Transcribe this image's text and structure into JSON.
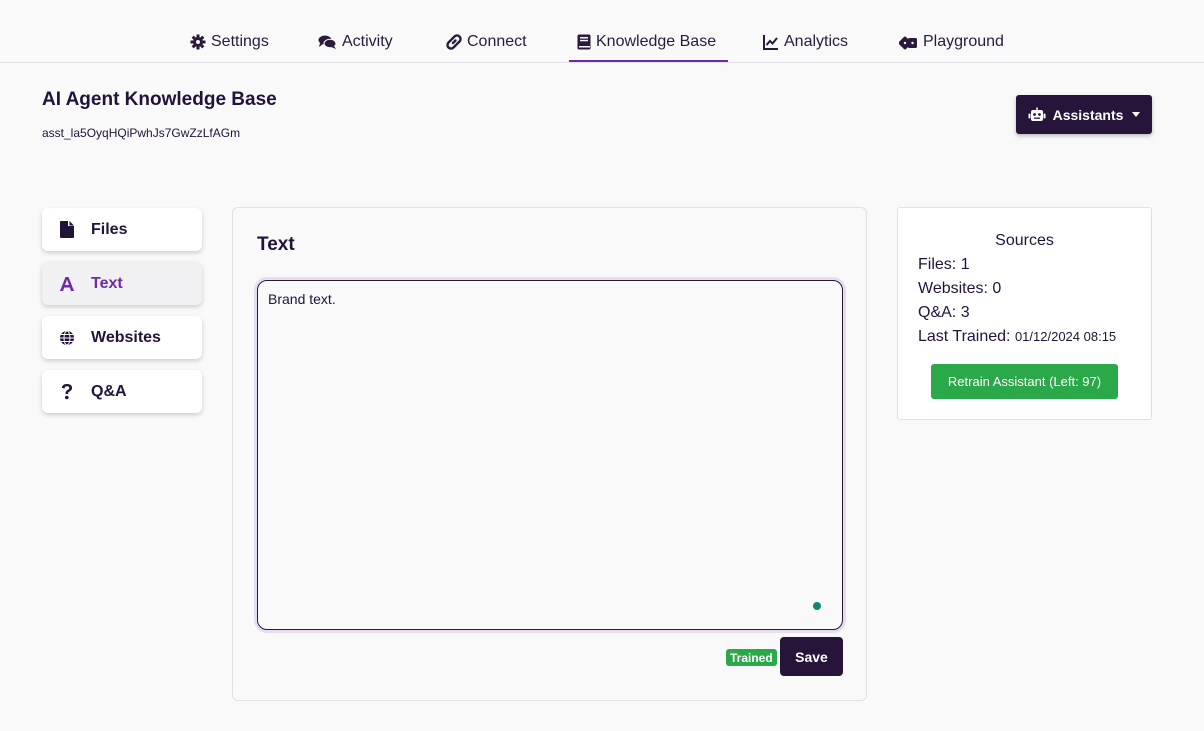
{
  "nav": {
    "tabs": [
      {
        "label": "Settings",
        "icon": "gear-icon"
      },
      {
        "label": "Activity",
        "icon": "comments-icon"
      },
      {
        "label": "Connect",
        "icon": "link-icon"
      },
      {
        "label": "Knowledge Base",
        "icon": "book-icon",
        "active": true
      },
      {
        "label": "Analytics",
        "icon": "line-chart-icon"
      },
      {
        "label": "Playground",
        "icon": "dice-icon"
      }
    ]
  },
  "header": {
    "title": "AI Agent Knowledge Base",
    "assistant_id": "asst_la5OyqHQiPwhJs7GwZzLfAGm",
    "assistants_button": "Assistants"
  },
  "sidebar": {
    "items": [
      {
        "label": "Files",
        "icon": "file-icon"
      },
      {
        "label": "Text",
        "icon": "font-icon",
        "active": true
      },
      {
        "label": "Websites",
        "icon": "globe-icon"
      },
      {
        "label": "Q&A",
        "icon": "question-icon"
      }
    ]
  },
  "text_panel": {
    "title": "Text",
    "content": "Brand text.",
    "status_badge": "Trained",
    "save_label": "Save"
  },
  "sources": {
    "title": "Sources",
    "files_label": "Files:",
    "files_value": "1",
    "websites_label": "Websites:",
    "websites_value": "0",
    "qa_label": "Q&A:",
    "qa_value": "3",
    "last_trained_label": "Last Trained:",
    "last_trained_value": "01/12/2024 08:15",
    "retrain_button": "Retrain Assistant (Left: 97)"
  },
  "colors": {
    "primary": "#27143a",
    "accent": "#6c2aa8",
    "success": "#2aa84a"
  }
}
